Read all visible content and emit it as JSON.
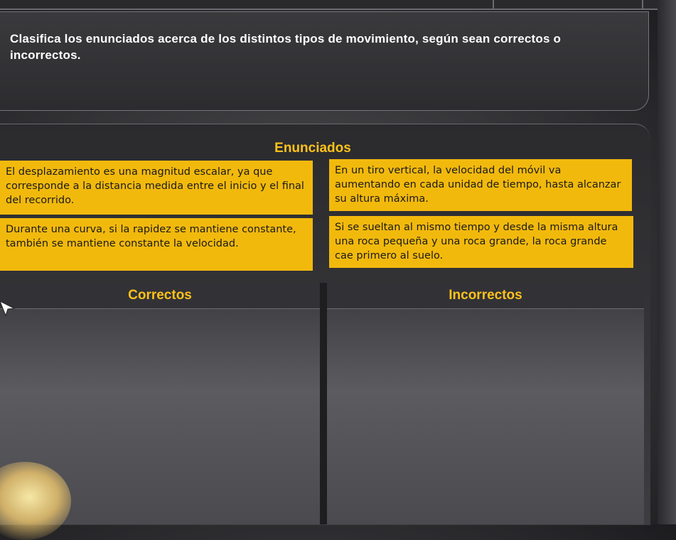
{
  "question": {
    "text": "Clasifica los enunciados acerca de los distintos tipos de movimiento, según sean correctos o incorrectos."
  },
  "bank": {
    "title": "Enunciados",
    "statements": [
      "El desplazamiento es una magnitud escalar, ya que corresponde a la distancia medida entre el inicio y el final del recorrido.",
      "En un tiro vertical, la velocidad del móvil va aumentando en cada unidad de tiempo, hasta alcanzar su altura máxima.",
      "Durante una curva, si la rapidez se mantiene constante, también se mantiene constante la velocidad.",
      "Si se sueltan al mismo tiempo y desde la misma altura una roca pequeña y una roca grande, la roca grande cae primero al suelo."
    ]
  },
  "columns": {
    "correct_label": "Correctos",
    "incorrect_label": "Incorrectos"
  },
  "colors": {
    "accent": "#ffc21a",
    "statement_bg": "#f2b90d"
  }
}
